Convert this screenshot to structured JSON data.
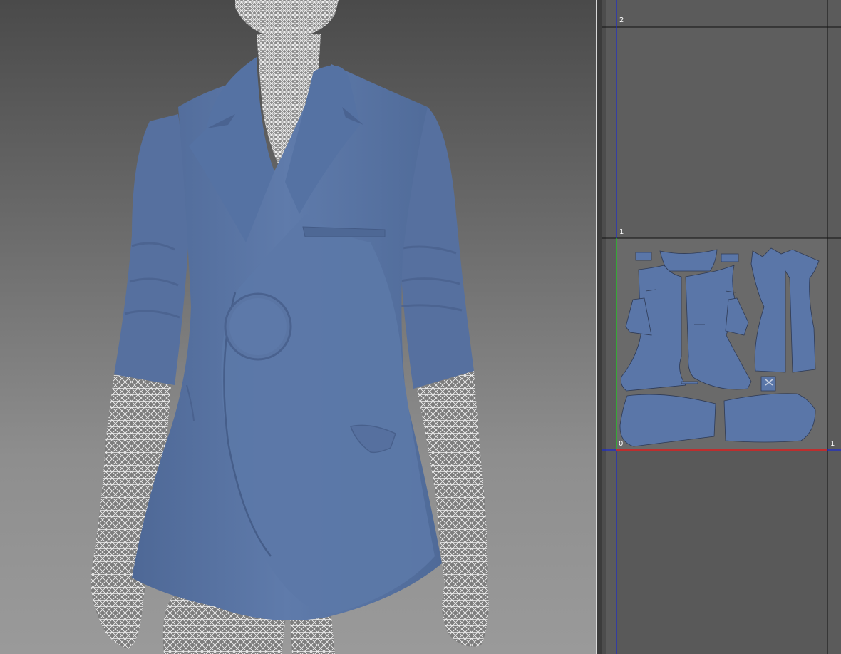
{
  "uv_editor": {
    "labels": {
      "v_top": "2",
      "v_mid": "1",
      "origin": "0",
      "u_right": "1"
    },
    "axis_colors": {
      "u_axis": "#e02020",
      "v_axis": "#20c020",
      "grid_blue": "#1a2ad0",
      "grid_black": "#000000"
    },
    "piece_color": "#5a76a8",
    "tile_color": "#6c6c6c"
  },
  "viewport": {
    "jacket_color": "#5b77a6",
    "wireframe_color": "#ffffff"
  }
}
